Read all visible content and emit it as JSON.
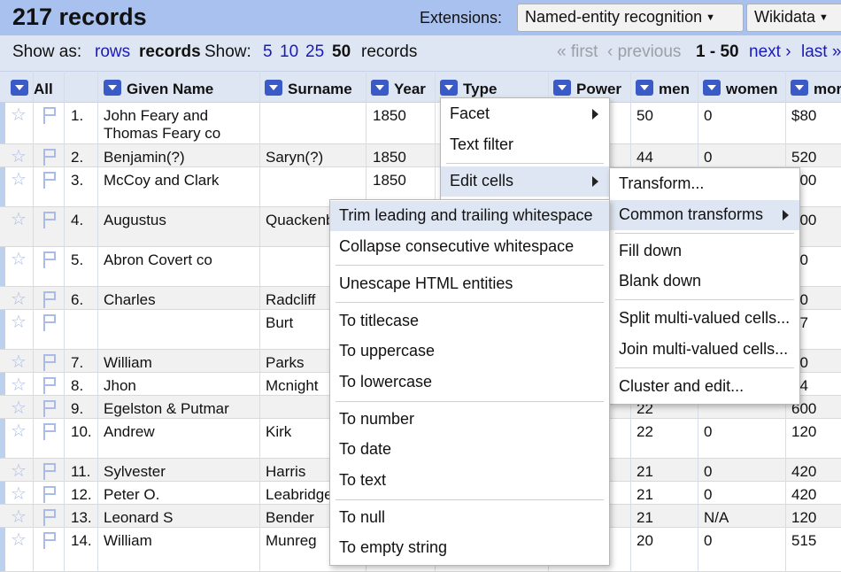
{
  "header": {
    "title": "217 records",
    "extensions_label": "Extensions:",
    "extension_dropdown": "Named-entity recognition",
    "wikidata_button": "Wikidata"
  },
  "pager": {
    "show_as": "Show as:",
    "rows": "rows",
    "records": "records",
    "show": "Show:",
    "sizes": [
      "5",
      "10",
      "25",
      "50"
    ],
    "current_size": "50",
    "records_word": "records",
    "first": "« first",
    "previous": "‹ previous",
    "range": "1 - 50",
    "next": "next ›",
    "last": "last »"
  },
  "columns": [
    "All",
    "Given Name",
    "Surname",
    "Year",
    "Type",
    "Power",
    "men",
    "women",
    "mor"
  ],
  "rows": [
    {
      "num": "1.",
      "given": "John Feary and",
      "given2": "Thomas Feary co",
      "surname": "",
      "year": "1850",
      "men": "50",
      "women": "0",
      "wage": "$80"
    },
    {
      "num": "2.",
      "given": "Benjamin(?)",
      "surname": "Saryn(?)",
      "year": "1850",
      "men": "44",
      "women": "0",
      "wage": "520"
    },
    {
      "num": "3.",
      "given": "McCoy and Clark",
      "surname": "",
      "year": "1850",
      "men": "",
      "women": "",
      "wage": "500"
    },
    {
      "num": "4.",
      "given": "Augustus",
      "surname": "Quackenb",
      "year": "",
      "men": "",
      "women": "",
      "wage": "500"
    },
    {
      "num": "5.",
      "given": "Abron Covert co",
      "surname": "",
      "year": "",
      "men": "",
      "women": "",
      "wage": "00"
    },
    {
      "num": "6.",
      "given": "Charles",
      "surname": "Radcliff",
      "year": "",
      "men": "",
      "women": "",
      "wage": "00"
    },
    {
      "num": "",
      "given": "",
      "surname": "Burt",
      "year": "",
      "men": "",
      "women": "",
      "wage": "97"
    },
    {
      "num": "7.",
      "given": "William",
      "surname": "Parks",
      "year": "",
      "men": "",
      "women": "",
      "wage": "00"
    },
    {
      "num": "8.",
      "given": "Jhon",
      "surname": "Mcnight",
      "year": "",
      "men": "",
      "women": "",
      "wage": "24"
    },
    {
      "num": "9.",
      "given": "Egelston & Putmar",
      "surname": "",
      "year": "",
      "men": "22",
      "women": "",
      "wage": "600"
    },
    {
      "num": "10.",
      "given": "Andrew",
      "surname": "Kirk",
      "year": "",
      "men": "22",
      "women": "0",
      "wage": "120"
    },
    {
      "num": "11.",
      "given": "Sylvester",
      "surname": "Harris",
      "year": "",
      "men": "21",
      "women": "0",
      "wage": "420"
    },
    {
      "num": "12.",
      "given": "Peter O.",
      "surname": "Leabridge",
      "year": "",
      "men": "21",
      "women": "0",
      "wage": "420"
    },
    {
      "num": "13.",
      "given": "Leonard S",
      "surname": "Bender",
      "year": "",
      "men": "21",
      "women": "N/A",
      "wage": "120"
    },
    {
      "num": "14.",
      "given": "William",
      "surname": "Munreg",
      "year": "",
      "men": "20",
      "women": "0",
      "wage": "515"
    }
  ],
  "menu_type": [
    "Facet",
    "Text filter",
    "Edit cells"
  ],
  "menu_edit_cells": [
    "Transform...",
    "Common transforms",
    "Fill down",
    "Blank down",
    "Split multi-valued cells...",
    "Join multi-valued cells...",
    "Cluster and edit..."
  ],
  "menu_common": [
    "Trim leading and trailing whitespace",
    "Collapse consecutive whitespace",
    "Unescape HTML entities",
    "To titlecase",
    "To uppercase",
    "To lowercase",
    "To number",
    "To date",
    "To text",
    "To null",
    "To empty string"
  ],
  "icons": {
    "star": "star-icon",
    "flag": "flag-icon",
    "dropdown": "column-dropdown-icon"
  },
  "colors": {
    "header_bg": "#a9c1ee",
    "bar_bg": "#dfe6f3",
    "link": "#1a1ab8",
    "dropdown": "#3a5bc7"
  }
}
